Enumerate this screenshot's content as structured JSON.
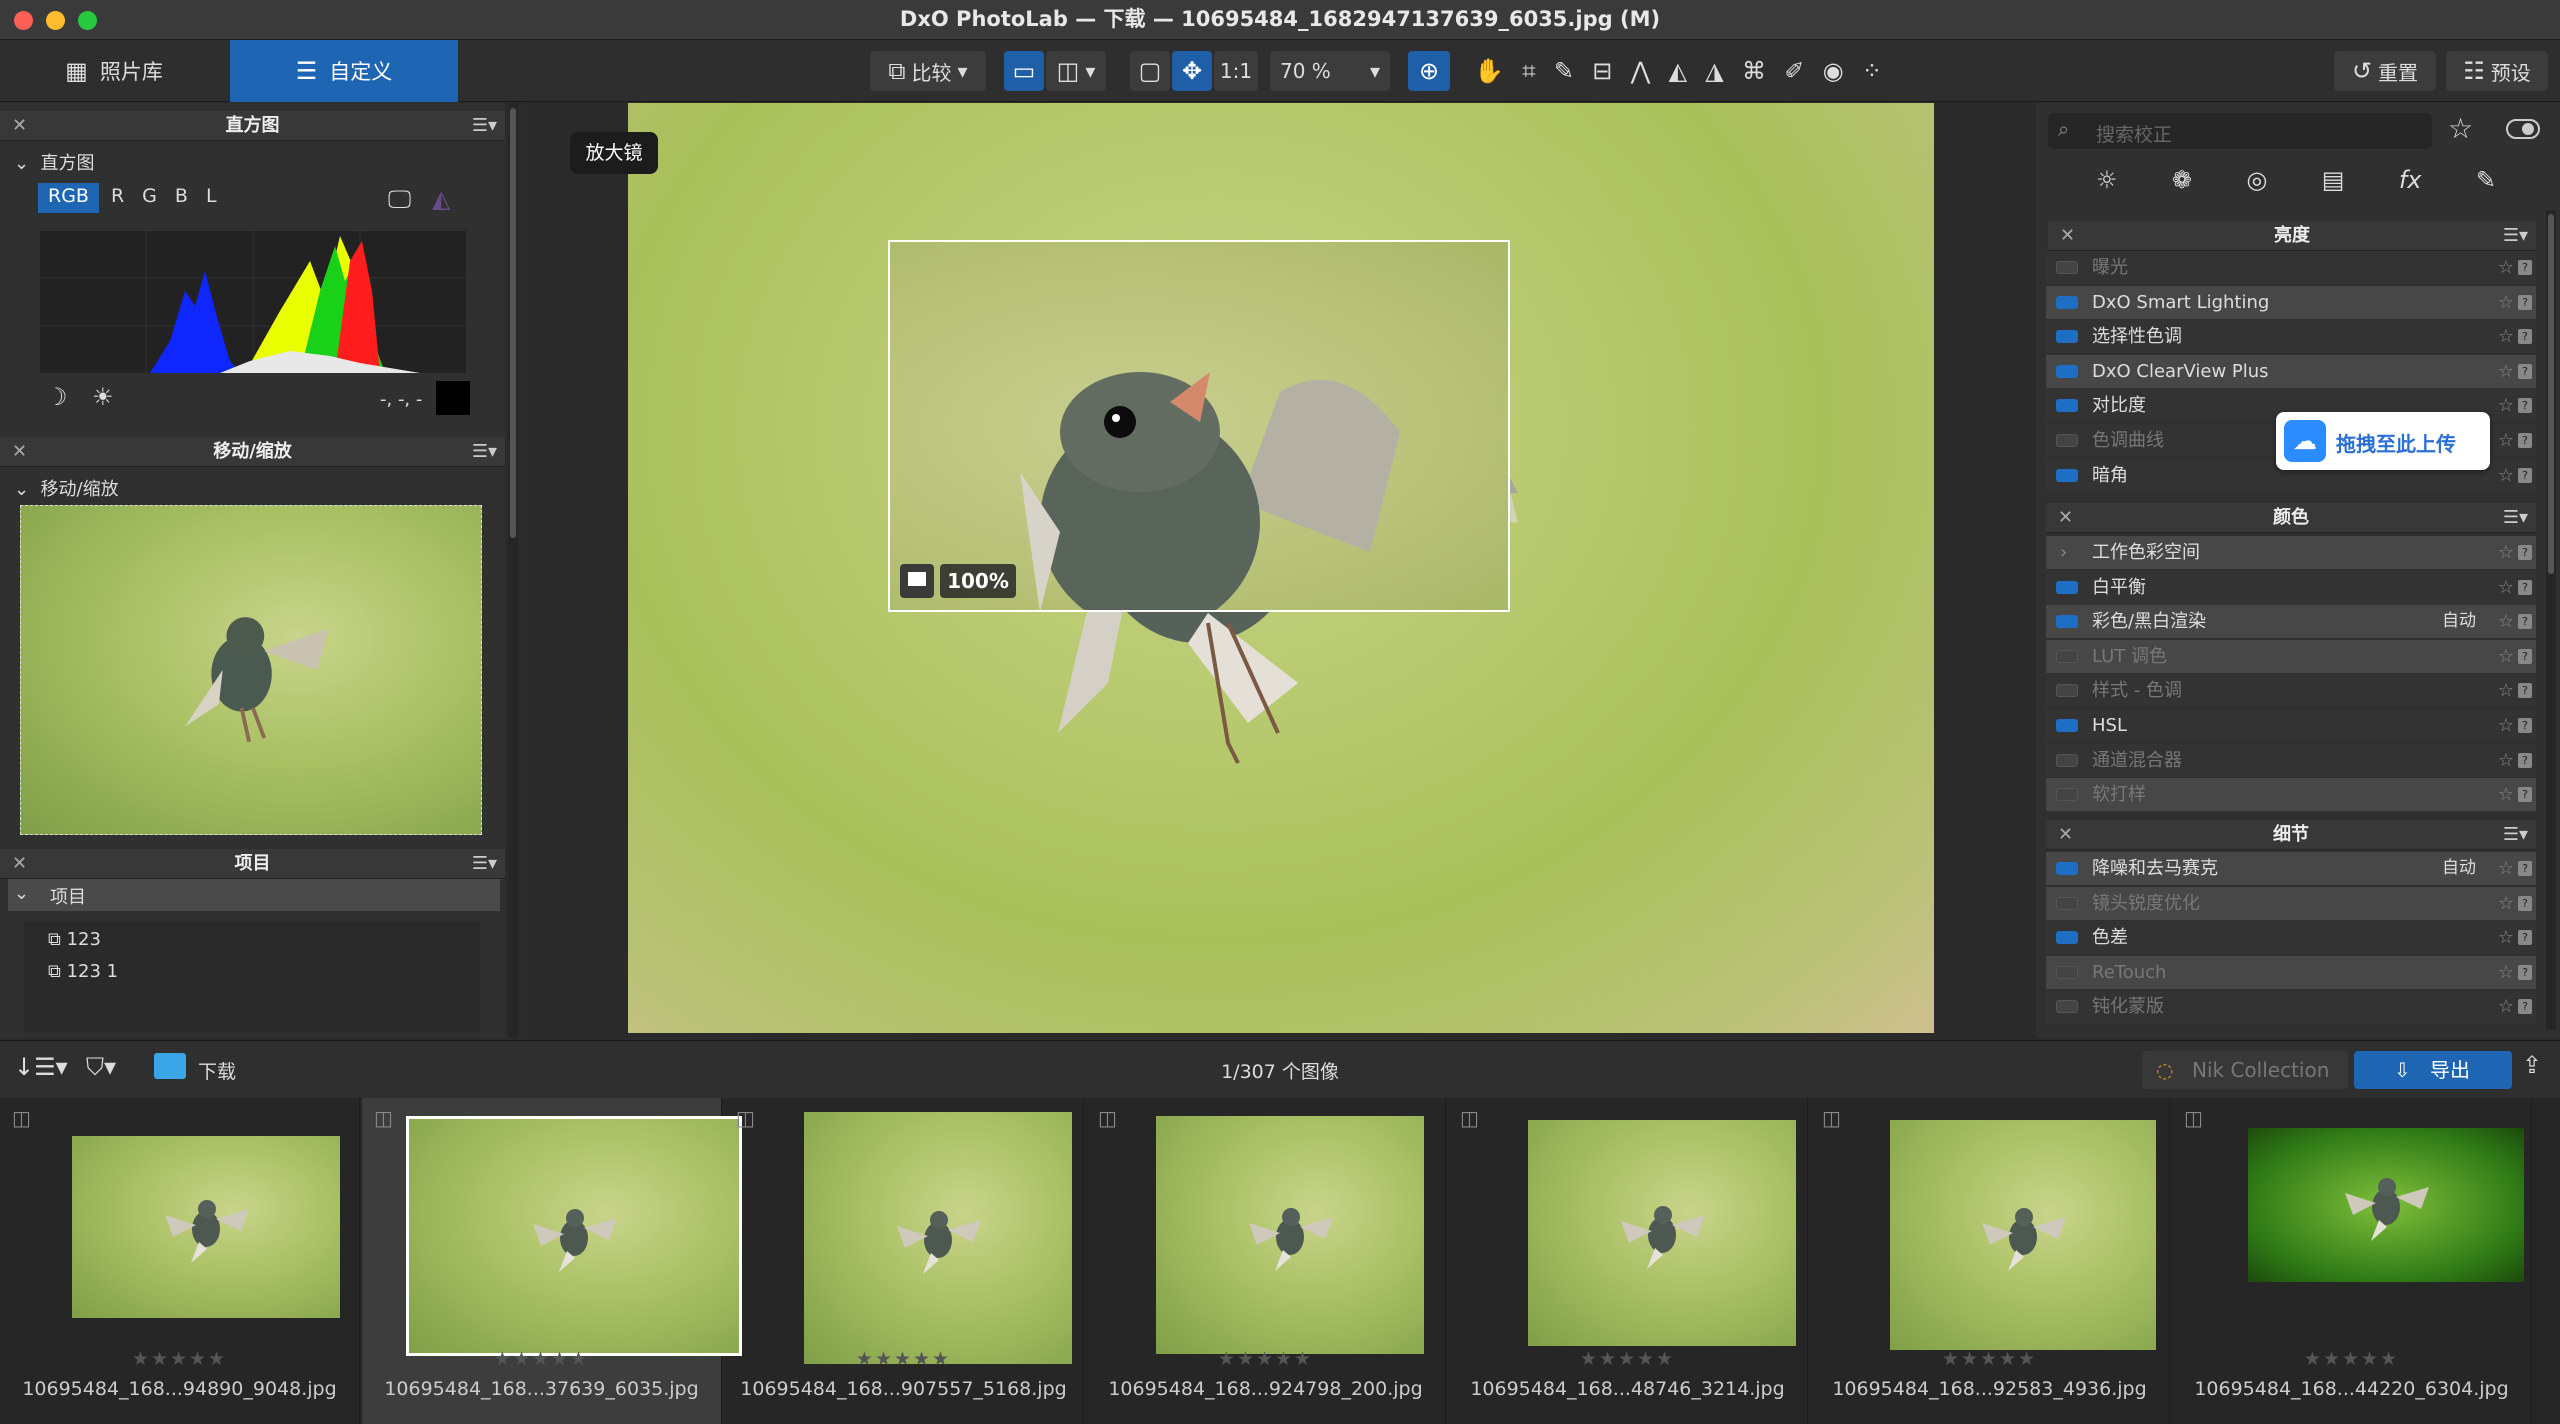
{
  "window": {
    "title": "DxO PhotoLab — 下载 — 10695484_1682947137639_6035.jpg (M)"
  },
  "toolbar": {
    "tab_library": "照片库",
    "tab_customize": "自定义",
    "compare": "比较",
    "ratio": "1:1",
    "zoom": "70 %",
    "reset": "重置",
    "presets": "预设"
  },
  "left": {
    "histogram": {
      "title": "直方图",
      "sub": "直方图",
      "channels": [
        "RGB",
        "R",
        "G",
        "B",
        "L"
      ],
      "readout": "-, -, -"
    },
    "navigator": {
      "title": "移动/缩放",
      "sub": "移动/缩放"
    },
    "projects": {
      "title": "项目",
      "sub": "项目",
      "items": [
        "123",
        "123 1"
      ]
    }
  },
  "viewer": {
    "tooltip": "放大镜",
    "loupe_zoom": "100%"
  },
  "right": {
    "search_placeholder": "搜索校正",
    "upload_badge": "拖拽至此上传",
    "sections": [
      {
        "title": "亮度",
        "rows": [
          {
            "label": "曝光",
            "on": false,
            "dim": true
          },
          {
            "label": "DxO Smart Lighting",
            "on": true,
            "hl": true
          },
          {
            "label": "选择性色调",
            "on": true
          },
          {
            "label": "DxO ClearView Plus",
            "on": true,
            "hl": true
          },
          {
            "label": "对比度",
            "on": true
          },
          {
            "label": "色调曲线",
            "on": false,
            "dim": true
          },
          {
            "label": "暗角",
            "on": true
          }
        ]
      },
      {
        "title": "颜色",
        "rows": [
          {
            "label": "工作色彩空间",
            "hl": true,
            "arrow": true
          },
          {
            "label": "白平衡",
            "on": true
          },
          {
            "label": "彩色/黑白渲染",
            "on": true,
            "hl": true,
            "auto": "自动"
          },
          {
            "label": "LUT 调色",
            "on": false,
            "dim": true,
            "hl": true
          },
          {
            "label": "样式 - 色调",
            "on": false,
            "dim": true
          },
          {
            "label": "HSL",
            "on": true
          },
          {
            "label": "通道混合器",
            "on": false,
            "dim": true
          },
          {
            "label": "软打样",
            "on": false,
            "dim": true,
            "hl": true
          }
        ]
      },
      {
        "title": "细节",
        "rows": [
          {
            "label": "降噪和去马赛克",
            "on": true,
            "hl": true,
            "auto": "自动"
          },
          {
            "label": "镜头锐度优化",
            "on": false,
            "dim": true,
            "hl": true
          },
          {
            "label": "色差",
            "on": true
          },
          {
            "label": "ReTouch",
            "on": false,
            "dim": true,
            "hl": true
          },
          {
            "label": "钝化蒙版",
            "on": false,
            "dim": true
          }
        ]
      }
    ]
  },
  "filmstrip": {
    "folder": "下载",
    "count": "1/307 个图像",
    "nik": "Nik Collection",
    "export": "导出",
    "items": [
      {
        "name": "10695484_168...94890_9048.jpg",
        "stars": "★★★★★"
      },
      {
        "name": "10695484_168...37639_6035.jpg",
        "stars": "★★★★★",
        "selected": true
      },
      {
        "name": "10695484_168...907557_5168.jpg",
        "stars": "★★★★★"
      },
      {
        "name": "10695484_168...924798_200.jpg",
        "stars": "★★★★★"
      },
      {
        "name": "10695484_168...48746_3214.jpg",
        "stars": "★★★★★"
      },
      {
        "name": "10695484_168...92583_4936.jpg",
        "stars": "★★★★★"
      },
      {
        "name": "10695484_168...44220_6304.jpg",
        "stars": "★★★★★"
      }
    ]
  }
}
